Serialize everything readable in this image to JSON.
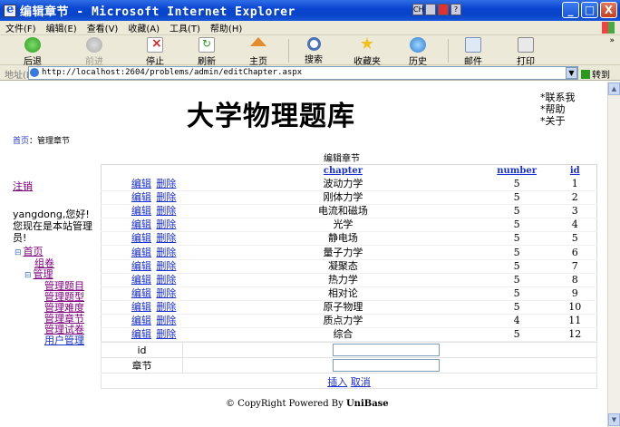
{
  "window": {
    "title": "编辑章节 - Microsoft Internet Explorer",
    "buttons": {
      "minimize": "_",
      "maximize": "□",
      "close": "X"
    }
  },
  "menu": [
    "文件(F)",
    "编辑(E)",
    "查看(V)",
    "收藏(A)",
    "工具(T)",
    "帮助(H)"
  ],
  "toolbar": {
    "back": "后退",
    "forward": "前进",
    "stop": "停止",
    "refresh": "刷新",
    "home": "主页",
    "search": "搜索",
    "favorites": "收藏夹",
    "history": "历史",
    "mail": "邮件",
    "print": "打印"
  },
  "address": {
    "label": "地址(D)",
    "url": "http://localhost:2604/problems/admin/editChapter.aspx",
    "go_label": "转到"
  },
  "site": {
    "title": "大学物理题库",
    "top_links": [
      "*联系我",
      "*帮助",
      "*关于"
    ]
  },
  "breadcrumb": {
    "home": "首页",
    "sep": "：",
    "current": "管理章节"
  },
  "sidebar": {
    "logout": "注销",
    "greeting": "yangdong,您好!您现在是本站管理员!",
    "tree": {
      "home": "首页",
      "compose": "组卷",
      "manage": "管理",
      "manage_items": [
        "管理题目",
        "管理题型",
        "管理难度",
        "管理章节",
        "管理试卷",
        "用户管理"
      ]
    }
  },
  "grid": {
    "caption": "编辑章节",
    "headers": {
      "chapter": "chapter",
      "number": "number",
      "id": "id"
    },
    "action_edit": "编辑",
    "action_delete": "删除",
    "rows": [
      {
        "chapter": "波动力学",
        "number": "5",
        "id": "1"
      },
      {
        "chapter": "刚体力学",
        "number": "5",
        "id": "2"
      },
      {
        "chapter": "电流和磁场",
        "number": "5",
        "id": "3"
      },
      {
        "chapter": "光学",
        "number": "5",
        "id": "4"
      },
      {
        "chapter": "静电场",
        "number": "5",
        "id": "5"
      },
      {
        "chapter": "量子力学",
        "number": "5",
        "id": "6"
      },
      {
        "chapter": "凝聚态",
        "number": "5",
        "id": "7"
      },
      {
        "chapter": "热力学",
        "number": "5",
        "id": "8"
      },
      {
        "chapter": "相对论",
        "number": "5",
        "id": "9"
      },
      {
        "chapter": "原子物理",
        "number": "5",
        "id": "10"
      },
      {
        "chapter": "质点力学",
        "number": "4",
        "id": "11"
      },
      {
        "chapter": "综合",
        "number": "5",
        "id": "12"
      }
    ]
  },
  "form": {
    "id_label": "id",
    "chapter_label": "章节",
    "id_value": "",
    "chapter_value": "",
    "insert": "插入",
    "cancel": "取消"
  },
  "footer": {
    "text": "© CopyRight Powered By ",
    "brand": "UniBase"
  }
}
